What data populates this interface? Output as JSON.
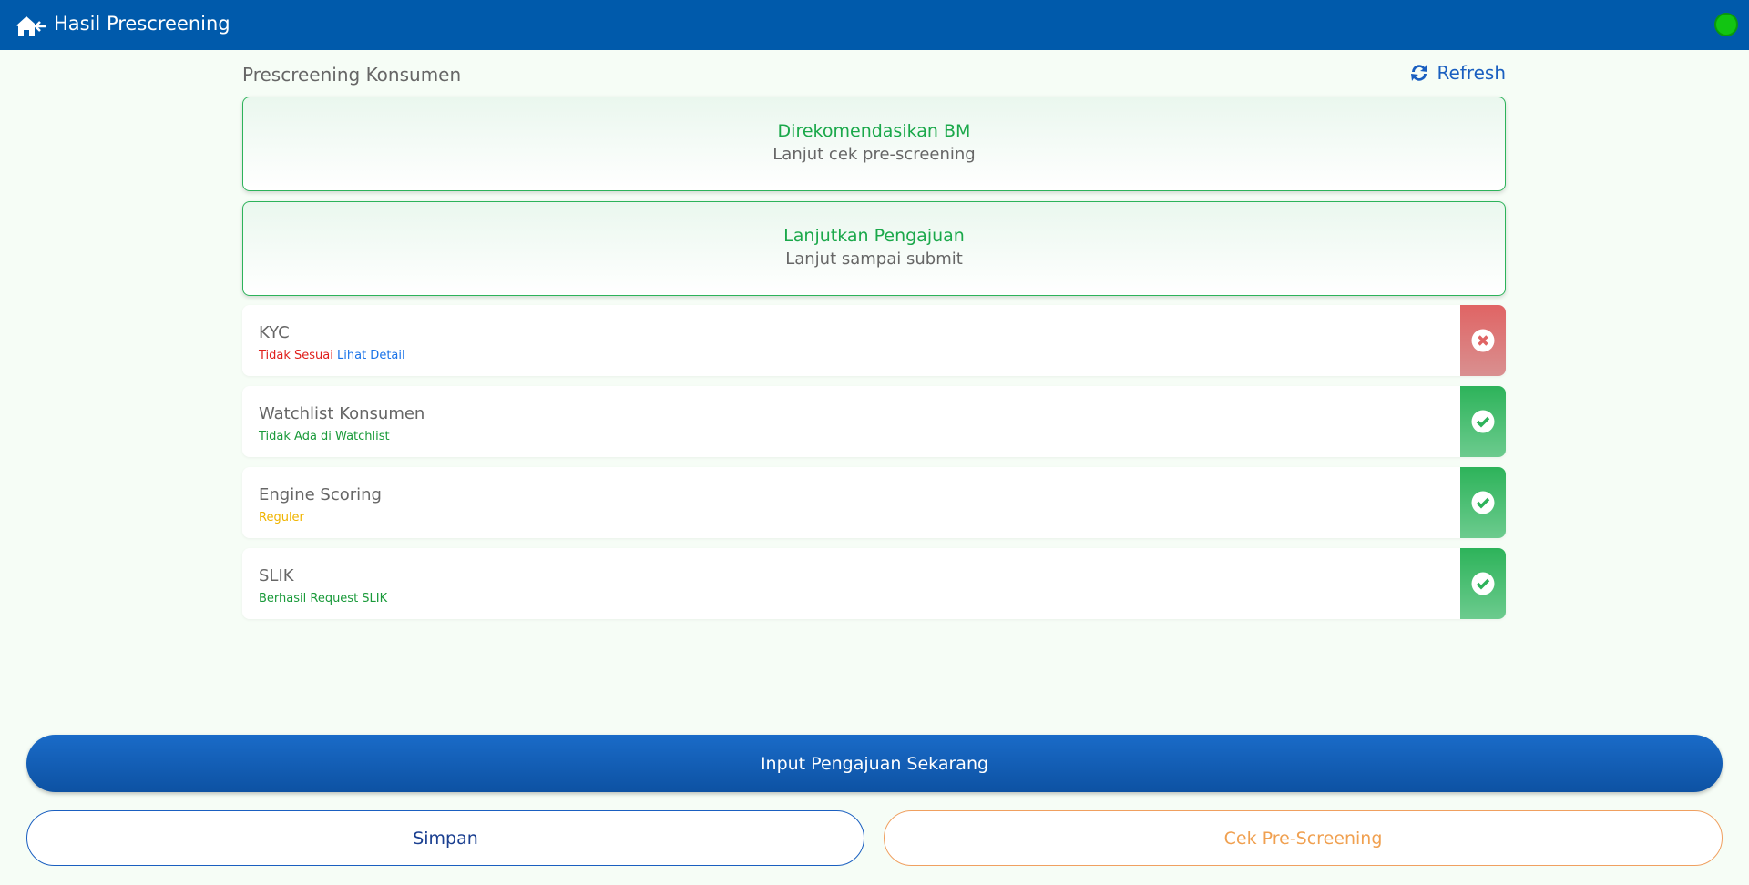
{
  "header": {
    "title": "Hasil Prescreening"
  },
  "section": {
    "title": "Prescreening Konsumen",
    "refresh_label": "Refresh"
  },
  "cards": [
    {
      "title": "Direkomendasikan BM",
      "subtitle": "Lanjut cek pre-screening"
    },
    {
      "title": "Lanjutkan Pengajuan",
      "subtitle": "Lanjut sampai submit"
    }
  ],
  "checks": [
    {
      "name": "KYC",
      "status": "Tidak Sesuai",
      "status_color": "#e0201c",
      "link": "Lihat Detail",
      "result": "fail"
    },
    {
      "name": "Watchlist Konsumen",
      "status": "Tidak Ada di Watchlist",
      "status_color": "#1a9a3a",
      "result": "pass"
    },
    {
      "name": "Engine Scoring",
      "status": "Reguler",
      "status_color": "#f0b400",
      "result": "pass"
    },
    {
      "name": "SLIK",
      "status": "Berhasil Request SLIK",
      "status_color": "#1a9a3a",
      "result": "pass"
    }
  ],
  "buttons": {
    "primary": "Input Pengajuan Sekarang",
    "save": "Simpan",
    "check": "Cek Pre-Screening"
  }
}
